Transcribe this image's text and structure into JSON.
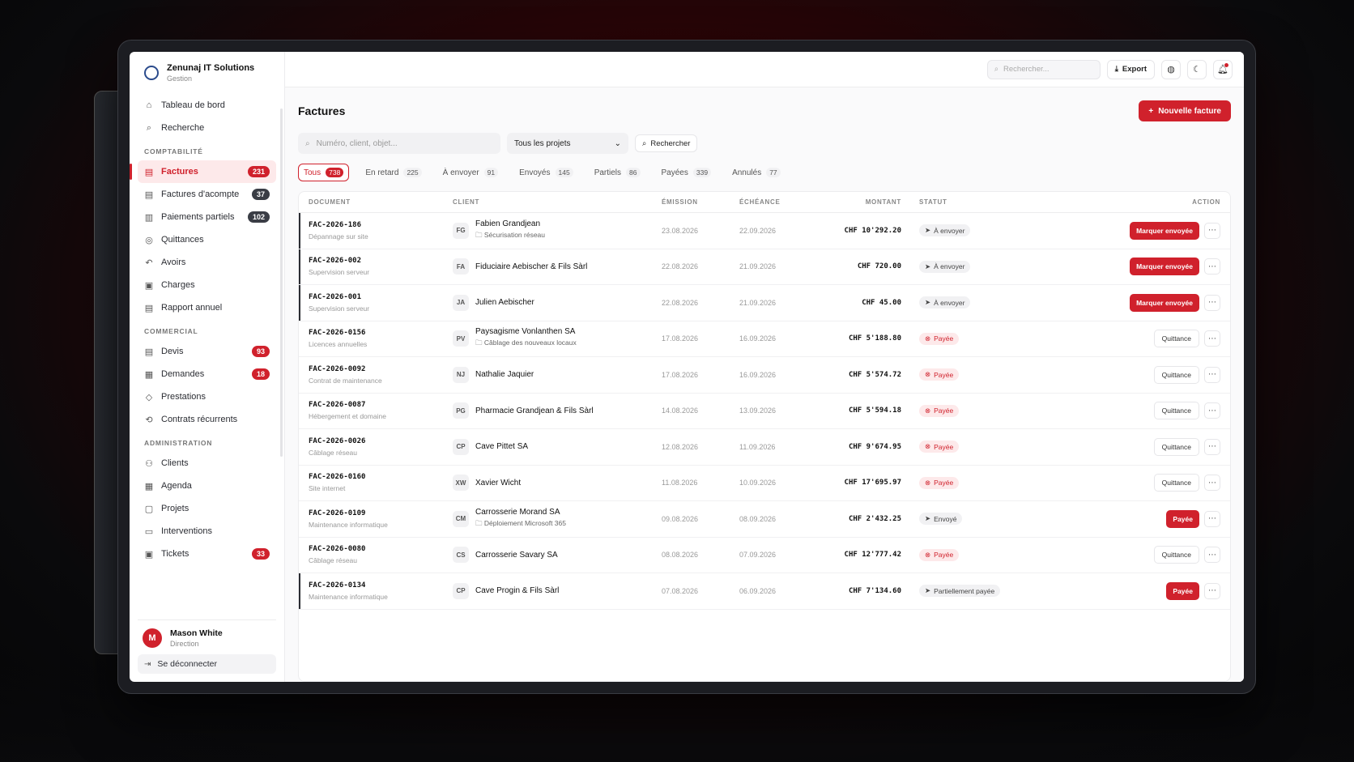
{
  "brand": {
    "name": "Zenunaj IT Solutions",
    "sub": "Gestion"
  },
  "sidebar": {
    "top": [
      {
        "label": "Tableau de bord",
        "icon": "home-icon"
      },
      {
        "label": "Recherche",
        "icon": "search-icon"
      }
    ],
    "sections": [
      {
        "title": "COMPTABILITÉ",
        "items": [
          {
            "label": "Factures",
            "badge": "231",
            "badge_style": "red",
            "active": true
          },
          {
            "label": "Factures d'acompte",
            "badge": "37",
            "badge_style": "dark"
          },
          {
            "label": "Paiements partiels",
            "badge": "102",
            "badge_style": "dark"
          },
          {
            "label": "Quittances",
            "badge": ""
          },
          {
            "label": "Avoirs",
            "badge": ""
          },
          {
            "label": "Charges",
            "badge": ""
          },
          {
            "label": "Rapport annuel",
            "badge": ""
          }
        ]
      },
      {
        "title": "COMMERCIAL",
        "items": [
          {
            "label": "Devis",
            "badge": "93",
            "badge_style": "red"
          },
          {
            "label": "Demandes",
            "badge": "18",
            "badge_style": "red"
          },
          {
            "label": "Prestations",
            "badge": ""
          },
          {
            "label": "Contrats récurrents",
            "badge": ""
          }
        ]
      },
      {
        "title": "ADMINISTRATION",
        "items": [
          {
            "label": "Clients",
            "badge": ""
          },
          {
            "label": "Agenda",
            "badge": ""
          },
          {
            "label": "Projets",
            "badge": ""
          },
          {
            "label": "Interventions",
            "badge": ""
          },
          {
            "label": "Tickets",
            "badge": "33",
            "badge_style": "red"
          }
        ]
      }
    ]
  },
  "user": {
    "initial": "M",
    "name": "Mason White",
    "role": "Direction",
    "logout": "Se déconnecter"
  },
  "topbar": {
    "search_placeholder": "Rechercher...",
    "export": "Export"
  },
  "page": {
    "title": "Factures",
    "new_button": "Nouvelle facture"
  },
  "filters": {
    "search_placeholder": "Numéro, client, objet...",
    "project_select": "Tous les projets",
    "search_button": "Rechercher"
  },
  "tabs": [
    {
      "label": "Tous",
      "count": "738",
      "active": true
    },
    {
      "label": "En retard",
      "count": "225"
    },
    {
      "label": "À envoyer",
      "count": "91"
    },
    {
      "label": "Envoyés",
      "count": "145"
    },
    {
      "label": "Partiels",
      "count": "86"
    },
    {
      "label": "Payées",
      "count": "339"
    },
    {
      "label": "Annulés",
      "count": "77"
    }
  ],
  "table": {
    "headers": {
      "document": "DOCUMENT",
      "client": "CLIENT",
      "emission": "ÉMISSION",
      "echeance": "ÉCHÉANCE",
      "montant": "MONTANT",
      "statut": "STATUT",
      "action": "ACTION"
    },
    "rows": [
      {
        "num": "FAC-2026-186",
        "desc": "Dépannage sur site",
        "ini": "FG",
        "client": "Fabien Grandjean",
        "project": "Sécurisation réseau",
        "em": "23.08.2026",
        "ech": "22.09.2026",
        "amount": "CHF 10'292.20",
        "status": "À envoyer",
        "status_type": "send",
        "action": "Marquer envoyée",
        "action_type": "red",
        "flag": true
      },
      {
        "num": "FAC-2026-002",
        "desc": "Supervision serveur",
        "ini": "FA",
        "client": "Fiduciaire Aebischer & Fils Sàrl",
        "project": "",
        "em": "22.08.2026",
        "ech": "21.09.2026",
        "amount": "CHF 720.00",
        "status": "À envoyer",
        "status_type": "send",
        "action": "Marquer envoyée",
        "action_type": "red",
        "flag": true
      },
      {
        "num": "FAC-2026-001",
        "desc": "Supervision serveur",
        "ini": "JA",
        "client": "Julien Aebischer",
        "project": "",
        "em": "22.08.2026",
        "ech": "21.09.2026",
        "amount": "CHF 45.00",
        "status": "À envoyer",
        "status_type": "send",
        "action": "Marquer envoyée",
        "action_type": "red",
        "flag": true
      },
      {
        "num": "FAC-2026-0156",
        "desc": "Licences annuelles",
        "ini": "PV",
        "client": "Paysagisme Vonlanthen SA",
        "project": "Câblage des nouveaux locaux",
        "em": "17.08.2026",
        "ech": "16.09.2026",
        "amount": "CHF 5'188.80",
        "status": "Payée",
        "status_type": "paid",
        "action": "Quittance",
        "action_type": "out",
        "flag": false
      },
      {
        "num": "FAC-2026-0092",
        "desc": "Contrat de maintenance",
        "ini": "NJ",
        "client": "Nathalie Jaquier",
        "project": "",
        "em": "17.08.2026",
        "ech": "16.09.2026",
        "amount": "CHF 5'574.72",
        "status": "Payée",
        "status_type": "paid",
        "action": "Quittance",
        "action_type": "out",
        "flag": false
      },
      {
        "num": "FAC-2026-0087",
        "desc": "Hébergement et domaine",
        "ini": "PG",
        "client": "Pharmacie Grandjean & Fils Sàrl",
        "project": "",
        "em": "14.08.2026",
        "ech": "13.09.2026",
        "amount": "CHF 5'594.18",
        "status": "Payée",
        "status_type": "paid",
        "action": "Quittance",
        "action_type": "out",
        "flag": false
      },
      {
        "num": "FAC-2026-0026",
        "desc": "Câblage réseau",
        "ini": "CP",
        "client": "Cave Pittet SA",
        "project": "",
        "em": "12.08.2026",
        "ech": "11.09.2026",
        "amount": "CHF 9'674.95",
        "status": "Payée",
        "status_type": "paid",
        "action": "Quittance",
        "action_type": "out",
        "flag": false
      },
      {
        "num": "FAC-2026-0160",
        "desc": "Site internet",
        "ini": "XW",
        "client": "Xavier Wicht",
        "project": "",
        "em": "11.08.2026",
        "ech": "10.09.2026",
        "amount": "CHF 17'695.97",
        "status": "Payée",
        "status_type": "paid",
        "action": "Quittance",
        "action_type": "out",
        "flag": false
      },
      {
        "num": "FAC-2026-0109",
        "desc": "Maintenance informatique",
        "ini": "CM",
        "client": "Carrosserie Morand SA",
        "project": "Déploiement Microsoft 365",
        "em": "09.08.2026",
        "ech": "08.09.2026",
        "amount": "CHF 2'432.25",
        "status": "Envoyé",
        "status_type": "send",
        "action": "Payée",
        "action_type": "red",
        "flag": false
      },
      {
        "num": "FAC-2026-0080",
        "desc": "Câblage réseau",
        "ini": "CS",
        "client": "Carrosserie Savary SA",
        "project": "",
        "em": "08.08.2026",
        "ech": "07.09.2026",
        "amount": "CHF 12'777.42",
        "status": "Payée",
        "status_type": "paid",
        "action": "Quittance",
        "action_type": "out",
        "flag": false
      },
      {
        "num": "FAC-2026-0134",
        "desc": "Maintenance informatique",
        "ini": "CP",
        "client": "Cave Progin & Fils Sàrl",
        "project": "",
        "em": "07.08.2026",
        "ech": "06.09.2026",
        "amount": "CHF 7'134.60",
        "status": "Partiellement payée",
        "status_type": "send",
        "action": "Payée",
        "action_type": "red",
        "flag": true
      }
    ]
  }
}
